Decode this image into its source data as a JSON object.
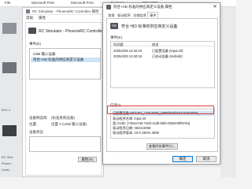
{
  "taskbar": {
    "items": [
      "File",
      "Microsoft Print",
      "Microsoft Print",
      "OneNote",
      "WPS PDF"
    ]
  },
  "desktop": {
    "labels": [
      "RX1-1",
      "RC Sim..",
      "Phoen..",
      "Contr..."
    ]
  },
  "bg_window": {
    "title": "RC Simulator - PhoenixRC Controller 属性",
    "tabs": [
      "常规",
      "属性"
    ],
    "device_name": "RC Simulator - PhoenixRC Controller",
    "events_label": "事件(E)",
    "items": [
      "USB 输入设备",
      "符合 HID 标准的供应商定义设备"
    ],
    "manufacturer_label": "设备制造商:",
    "manufacturer_value": "(标准系统设备)",
    "location_label": "位置:",
    "location_value": "位置 0 (USB 输入设备)",
    "status_label": "设备状态",
    "button_label": "属性(R)"
  },
  "window": {
    "title": "符合 HID 标准的供应商定义设备 属性",
    "close_glyph": "✕",
    "tabs": [
      "常规",
      "驱动程序",
      "详细信息",
      "事件"
    ],
    "active_tab": "事件",
    "device_name": "符合 HID 标准的供应商定义设备",
    "events_label": "事件(E)",
    "events_headers": [
      "时间戳",
      "描述"
    ],
    "events": [
      {
        "time": "2025/4/29 13:40:19",
        "desc": "已配置设备 (input.inf)"
      },
      {
        "time": "2025/4/29 13:40:19",
        "desc": "已启动设备 (HidUsb)"
      }
    ],
    "info_label": "信息(I)",
    "info_rows": [
      "已配置设备 HID\\VID_1781&PID_0898\\6&6b5d44&0&0000。",
      "驱动程序名称: input.inf",
      "类 GUID: {745a17a0-74d3-11d0-b6fe-00a0c90f57da}",
      "驱动程序日期: 06/21/2006",
      "驱动程序版本: 10.0.19041.3636"
    ],
    "view_all_button": "查看所有事件(V)...",
    "ok_button": "确定",
    "cancel_button": "取消"
  },
  "colors": {
    "highlight": "#e53935",
    "selection": "#cce4f7"
  }
}
